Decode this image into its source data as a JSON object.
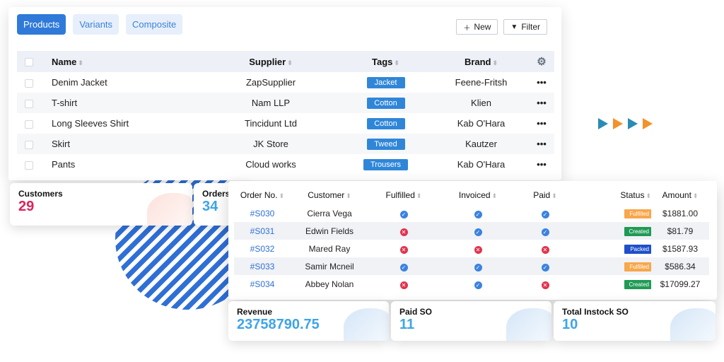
{
  "colors": {
    "primary": "#2f7ad9",
    "tag": "#2f86d9",
    "pink": "#e0215c",
    "blue": "#3ea4e8",
    "fulfilled": "#f8a74b",
    "created": "#1f9a55",
    "packed": "#1f4fc9",
    "arrow_teal": "#2b8bb5",
    "arrow_orange": "#f2922b"
  },
  "products": {
    "tabs": [
      {
        "label": "Products",
        "active": true
      },
      {
        "label": "Variants",
        "active": false
      },
      {
        "label": "Composite",
        "active": false
      }
    ],
    "toolbar": {
      "new_label": "New",
      "new_icon": "plus-icon",
      "filter_label": "Filter",
      "filter_icon": "filter-icon"
    },
    "columns": {
      "name": "Name",
      "supplier": "Supplier",
      "tags": "Tags",
      "brand": "Brand"
    },
    "rows": [
      {
        "name": "Denim Jacket",
        "supplier": "ZapSupplier",
        "tag": "Jacket",
        "brand": "Feene-Fritsh",
        "action": "•••"
      },
      {
        "name": "T-shirt",
        "supplier": "Nam LLP",
        "tag": "Cotton",
        "brand": "Klien",
        "action": "•••"
      },
      {
        "name": "Long Sleeves Shirt",
        "supplier": "Tincidunt Ltd",
        "tag": "Cotton",
        "brand": "Kab O'Hara",
        "action": "•••"
      },
      {
        "name": "Skirt",
        "supplier": "JK Store",
        "tag": "Tweed",
        "brand": "Kautzer",
        "action": "•••"
      },
      {
        "name": "Pants",
        "supplier": "Cloud works",
        "tag": "Trousers",
        "brand": "Kab O'Hara",
        "action": "•••"
      }
    ]
  },
  "stats": {
    "customers": {
      "label": "Customers",
      "value": "29"
    },
    "orders": {
      "label": "Orders",
      "value": "34"
    },
    "revenue": {
      "label": "Revenue",
      "value": "23758790.75"
    },
    "paid_so": {
      "label": "Paid SO",
      "value": "11"
    },
    "instock_so": {
      "label": "Total Instock SO",
      "value": "10"
    }
  },
  "orders": {
    "columns": {
      "order_no": "Order No.",
      "customer": "Customer",
      "fulfilled": "Fulfilled",
      "invoiced": "Invoiced",
      "paid": "Paid",
      "status": "Status",
      "amount": "Amount"
    },
    "rows": [
      {
        "order_no": "#S030",
        "customer": "Cierra Vega",
        "fulfilled": true,
        "invoiced": true,
        "paid": true,
        "status": "Fulfilled",
        "amount": "$1881.00"
      },
      {
        "order_no": "#S031",
        "customer": "Edwin Fields",
        "fulfilled": false,
        "invoiced": true,
        "paid": true,
        "status": "Created",
        "amount": "$81.79"
      },
      {
        "order_no": "#S032",
        "customer": "Mared Ray",
        "fulfilled": false,
        "invoiced": false,
        "paid": false,
        "status": "Packed",
        "amount": "$1587.93"
      },
      {
        "order_no": "#S033",
        "customer": "Samir Mcneil",
        "fulfilled": true,
        "invoiced": true,
        "paid": true,
        "status": "Fulfilled",
        "amount": "$586.34"
      },
      {
        "order_no": "#S034",
        "customer": "Abbey Nolan",
        "fulfilled": false,
        "invoiced": true,
        "paid": false,
        "status": "Created",
        "amount": "$17099.27"
      }
    ]
  }
}
